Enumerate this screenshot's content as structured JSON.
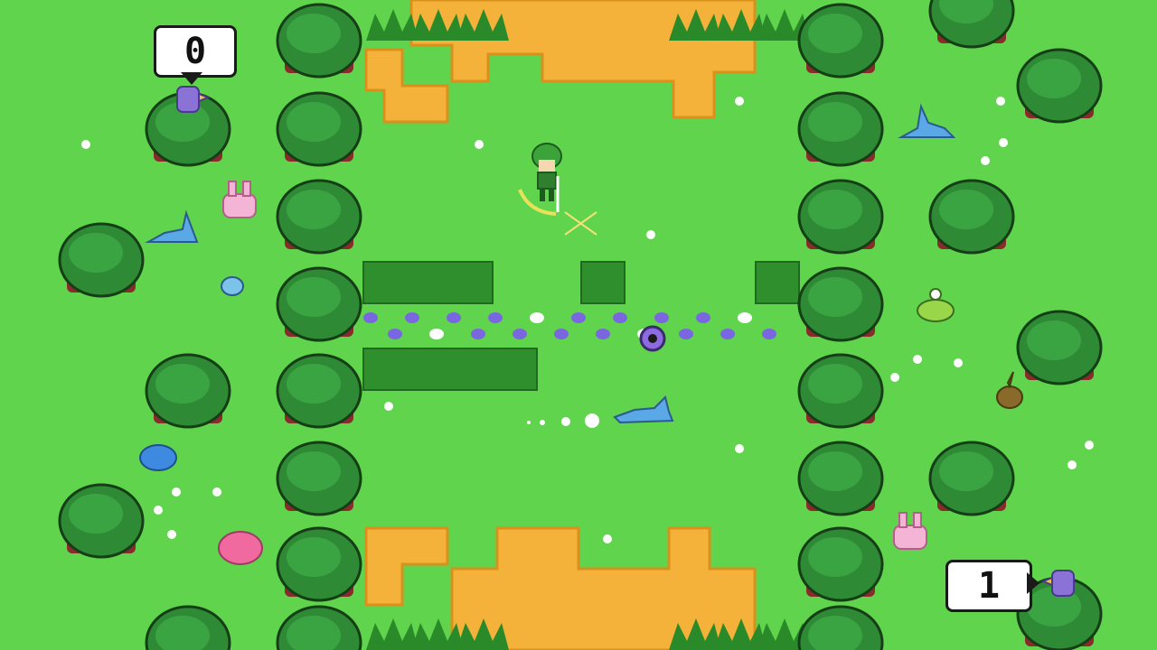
{
  "hud": {
    "score_left": "0",
    "score_right": "1"
  },
  "colors": {
    "grass": "#5fd44c",
    "path_sand": "#f4b23a",
    "tree_canopy": "#2e8a35",
    "tree_trunk": "#8a2a2a",
    "tall_grass": "#2f8f2c",
    "flower_purple": "#7a66e0"
  },
  "sprites": {
    "player": "green-haired-hero",
    "enemies": [
      "blue-fox",
      "pink-bunny",
      "purple-bird",
      "blue-slime",
      "pink-blob",
      "green-slime",
      "brown-sprout"
    ],
    "pickup": "purple-orb"
  }
}
